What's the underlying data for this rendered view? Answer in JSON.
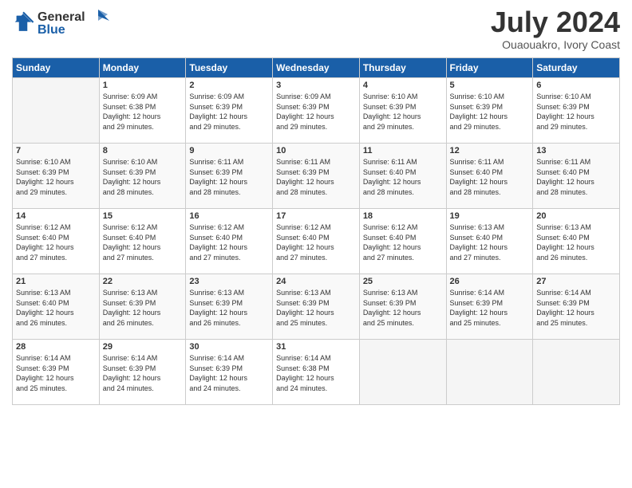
{
  "header": {
    "logo_general": "General",
    "logo_blue": "Blue",
    "month_title": "July 2024",
    "location": "Ouaouakro, Ivory Coast"
  },
  "days_of_week": [
    "Sunday",
    "Monday",
    "Tuesday",
    "Wednesday",
    "Thursday",
    "Friday",
    "Saturday"
  ],
  "weeks": [
    [
      {
        "day": "",
        "info": ""
      },
      {
        "day": "1",
        "info": "Sunrise: 6:09 AM\nSunset: 6:38 PM\nDaylight: 12 hours\nand 29 minutes."
      },
      {
        "day": "2",
        "info": "Sunrise: 6:09 AM\nSunset: 6:39 PM\nDaylight: 12 hours\nand 29 minutes."
      },
      {
        "day": "3",
        "info": "Sunrise: 6:09 AM\nSunset: 6:39 PM\nDaylight: 12 hours\nand 29 minutes."
      },
      {
        "day": "4",
        "info": "Sunrise: 6:10 AM\nSunset: 6:39 PM\nDaylight: 12 hours\nand 29 minutes."
      },
      {
        "day": "5",
        "info": "Sunrise: 6:10 AM\nSunset: 6:39 PM\nDaylight: 12 hours\nand 29 minutes."
      },
      {
        "day": "6",
        "info": "Sunrise: 6:10 AM\nSunset: 6:39 PM\nDaylight: 12 hours\nand 29 minutes."
      }
    ],
    [
      {
        "day": "7",
        "info": "Sunrise: 6:10 AM\nSunset: 6:39 PM\nDaylight: 12 hours\nand 29 minutes."
      },
      {
        "day": "8",
        "info": "Sunrise: 6:10 AM\nSunset: 6:39 PM\nDaylight: 12 hours\nand 28 minutes."
      },
      {
        "day": "9",
        "info": "Sunrise: 6:11 AM\nSunset: 6:39 PM\nDaylight: 12 hours\nand 28 minutes."
      },
      {
        "day": "10",
        "info": "Sunrise: 6:11 AM\nSunset: 6:39 PM\nDaylight: 12 hours\nand 28 minutes."
      },
      {
        "day": "11",
        "info": "Sunrise: 6:11 AM\nSunset: 6:40 PM\nDaylight: 12 hours\nand 28 minutes."
      },
      {
        "day": "12",
        "info": "Sunrise: 6:11 AM\nSunset: 6:40 PM\nDaylight: 12 hours\nand 28 minutes."
      },
      {
        "day": "13",
        "info": "Sunrise: 6:11 AM\nSunset: 6:40 PM\nDaylight: 12 hours\nand 28 minutes."
      }
    ],
    [
      {
        "day": "14",
        "info": "Sunrise: 6:12 AM\nSunset: 6:40 PM\nDaylight: 12 hours\nand 27 minutes."
      },
      {
        "day": "15",
        "info": "Sunrise: 6:12 AM\nSunset: 6:40 PM\nDaylight: 12 hours\nand 27 minutes."
      },
      {
        "day": "16",
        "info": "Sunrise: 6:12 AM\nSunset: 6:40 PM\nDaylight: 12 hours\nand 27 minutes."
      },
      {
        "day": "17",
        "info": "Sunrise: 6:12 AM\nSunset: 6:40 PM\nDaylight: 12 hours\nand 27 minutes."
      },
      {
        "day": "18",
        "info": "Sunrise: 6:12 AM\nSunset: 6:40 PM\nDaylight: 12 hours\nand 27 minutes."
      },
      {
        "day": "19",
        "info": "Sunrise: 6:13 AM\nSunset: 6:40 PM\nDaylight: 12 hours\nand 27 minutes."
      },
      {
        "day": "20",
        "info": "Sunrise: 6:13 AM\nSunset: 6:40 PM\nDaylight: 12 hours\nand 26 minutes."
      }
    ],
    [
      {
        "day": "21",
        "info": "Sunrise: 6:13 AM\nSunset: 6:40 PM\nDaylight: 12 hours\nand 26 minutes."
      },
      {
        "day": "22",
        "info": "Sunrise: 6:13 AM\nSunset: 6:39 PM\nDaylight: 12 hours\nand 26 minutes."
      },
      {
        "day": "23",
        "info": "Sunrise: 6:13 AM\nSunset: 6:39 PM\nDaylight: 12 hours\nand 26 minutes."
      },
      {
        "day": "24",
        "info": "Sunrise: 6:13 AM\nSunset: 6:39 PM\nDaylight: 12 hours\nand 25 minutes."
      },
      {
        "day": "25",
        "info": "Sunrise: 6:13 AM\nSunset: 6:39 PM\nDaylight: 12 hours\nand 25 minutes."
      },
      {
        "day": "26",
        "info": "Sunrise: 6:14 AM\nSunset: 6:39 PM\nDaylight: 12 hours\nand 25 minutes."
      },
      {
        "day": "27",
        "info": "Sunrise: 6:14 AM\nSunset: 6:39 PM\nDaylight: 12 hours\nand 25 minutes."
      }
    ],
    [
      {
        "day": "28",
        "info": "Sunrise: 6:14 AM\nSunset: 6:39 PM\nDaylight: 12 hours\nand 25 minutes."
      },
      {
        "day": "29",
        "info": "Sunrise: 6:14 AM\nSunset: 6:39 PM\nDaylight: 12 hours\nand 24 minutes."
      },
      {
        "day": "30",
        "info": "Sunrise: 6:14 AM\nSunset: 6:39 PM\nDaylight: 12 hours\nand 24 minutes."
      },
      {
        "day": "31",
        "info": "Sunrise: 6:14 AM\nSunset: 6:38 PM\nDaylight: 12 hours\nand 24 minutes."
      },
      {
        "day": "",
        "info": ""
      },
      {
        "day": "",
        "info": ""
      },
      {
        "day": "",
        "info": ""
      }
    ]
  ]
}
